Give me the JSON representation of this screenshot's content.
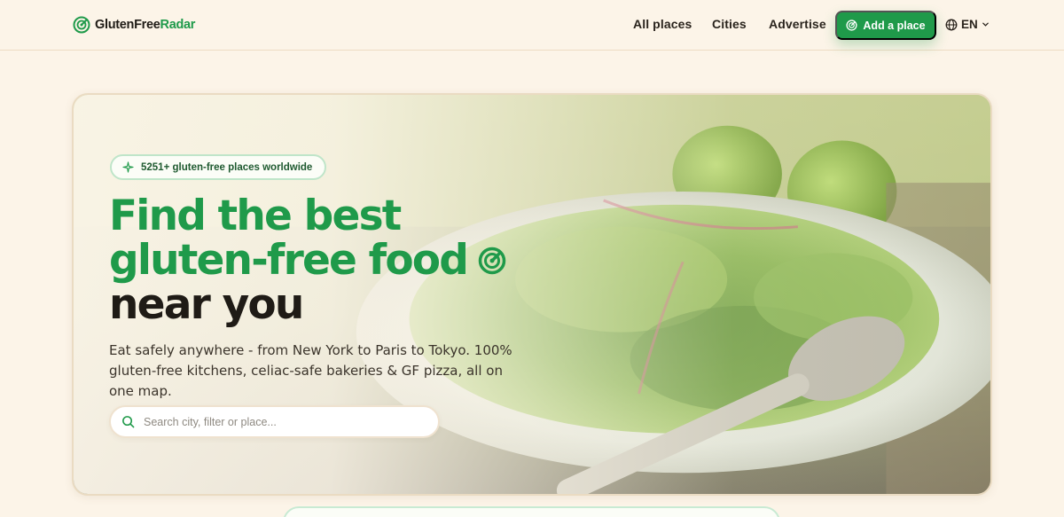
{
  "brand": {
    "name_part1": "GlutenFree",
    "name_part2": "Radar"
  },
  "nav": {
    "links": [
      "All places",
      "Cities",
      "Advertise"
    ],
    "cta_label": "Add a place",
    "language": "EN"
  },
  "hero": {
    "badge": "5251+ gluten-free places worldwide",
    "headline_line1": "Find the best",
    "headline_line2": "gluten-free food",
    "headline_line3": "near you",
    "subtitle": "Eat safely anywhere - from New York to Paris to Tokyo. 100% gluten-free kitchens, celiac-safe bakeries & GF pizza, all on one map.",
    "search_placeholder": "Search city, filter or place..."
  },
  "colors": {
    "accent": "#1f9a4a",
    "background": "#fcf4e8",
    "text_dark": "#1f1b16"
  },
  "icons": [
    "radar-logo-icon",
    "radar-icon",
    "globe-icon",
    "chevron-down-icon",
    "sparkle-icon",
    "search-icon"
  ]
}
